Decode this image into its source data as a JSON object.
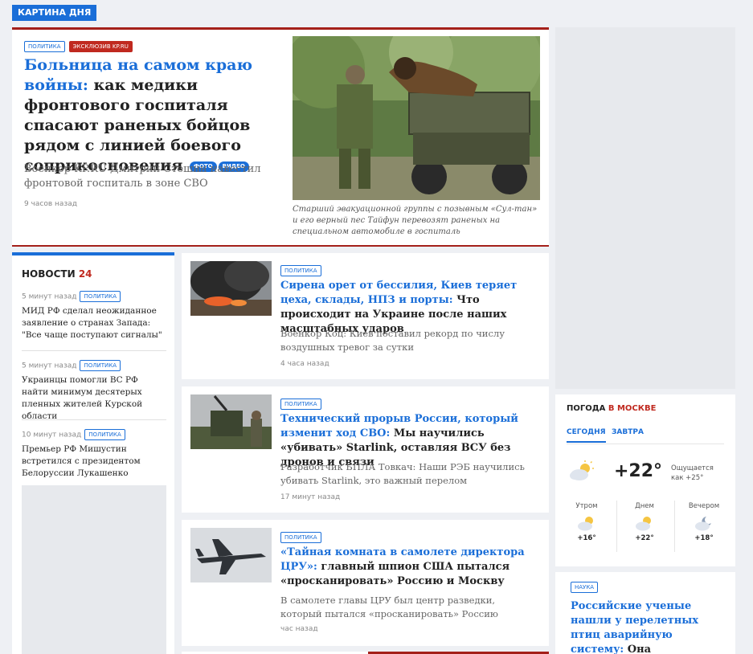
{
  "kartina_dnya": "КАРТИНА ДНЯ",
  "hero": {
    "tags": [
      "ПОЛИТИКА",
      "ЭКСКЛЮЗИВ KP.RU"
    ],
    "title_blue": "Больница на самом краю войны:",
    "title_rest": " как медики фронтового госпиталя спасают раненых бойцов рядом с линией боевого соприкосновения ",
    "badges": [
      "ФОТО",
      "ВИДЕО"
    ],
    "lead": "Военкор KP.RU Дмитрий Стешин навестил фронтовой госпиталь в зоне СВО",
    "time": "9 часов назад",
    "caption": "Старший эвакуационной группы с позывным «Сул-тан» и его верный пес Тайфун перевозят раненых на специальном автомобиле в госпиталь"
  },
  "news": {
    "title": "НОВОСТИ",
    "number": "24",
    "items": [
      {
        "time": "5 минут назад",
        "tag": "ПОЛИТИКА",
        "text": "МИД РФ сделал неожиданное заявление о странах Запада: \"Все чаще поступают сигналы\""
      },
      {
        "time": "5 минут назад",
        "tag": "ПОЛИТИКА",
        "text": "Украинцы помогли ВС РФ найти минимум десятерых пленных жителей Курской области"
      },
      {
        "time": "10 минут назад",
        "tag": "ПОЛИТИКА",
        "text": "Премьер РФ Мишустин встретился с президентом Белоруссии Лукашенко"
      }
    ]
  },
  "cards": [
    {
      "tag": "ПОЛИТИКА",
      "title_blue": "Сирена орет от бессилия, Киев теряет цеха, склады, НПЗ и порты:",
      "title_rest": " Что происходит на Украине после наших масштабных ударов",
      "lead": "Военкор Коц: Киев поставил рекорд по числу воздушных тревог за сутки",
      "time": "4 часа назад"
    },
    {
      "tag": "ПОЛИТИКА",
      "title_blue": "Технический прорыв России, который изменит ход СВО:",
      "title_rest": " Мы научились «убивать» Starlink, оставляя ВСУ без дронов и связи",
      "lead": "Разработчик БПЛА Товкач: Наши РЭБ научились убивать Starlink, это важный перелом",
      "time": "17 минут назад"
    },
    {
      "tag": "ПОЛИТИКА",
      "title_blue": "«Тайная комната в самолете директора ЦРУ»:",
      "title_rest": " главный шпион США пытался «просканировать» Россию и Москву",
      "lead": "В самолете главы ЦРУ был центр разведки, который пытался «просканировать» Россию",
      "time": "час назад"
    }
  ],
  "weather": {
    "title": "ПОГОДА",
    "city": "В МОСКВЕ",
    "tabs": [
      "СЕГОДНЯ",
      "ЗАВТРА"
    ],
    "now_temp": "+22°",
    "feels_label": "Ощущается",
    "feels_value": "как +25°",
    "now_icon": "partly-cloudy-icon",
    "parts": [
      {
        "label": "Утром",
        "temp": "+16°",
        "icon": "partly-cloudy-icon"
      },
      {
        "label": "Днем",
        "temp": "+22°",
        "icon": "partly-cloudy-icon"
      },
      {
        "label": "Вечером",
        "temp": "+18°",
        "icon": "cloudy-night-icon"
      }
    ]
  },
  "right_article": {
    "tag": "НАУКА",
    "title_blue": "Российские ученые нашли у перелетных птиц аварийную систему:",
    "title_rest": " Она включается во время магнитных"
  },
  "colors": {
    "accent": "#1a6ed8",
    "brand_red": "#c0291f",
    "border_red": "#a4201a"
  }
}
